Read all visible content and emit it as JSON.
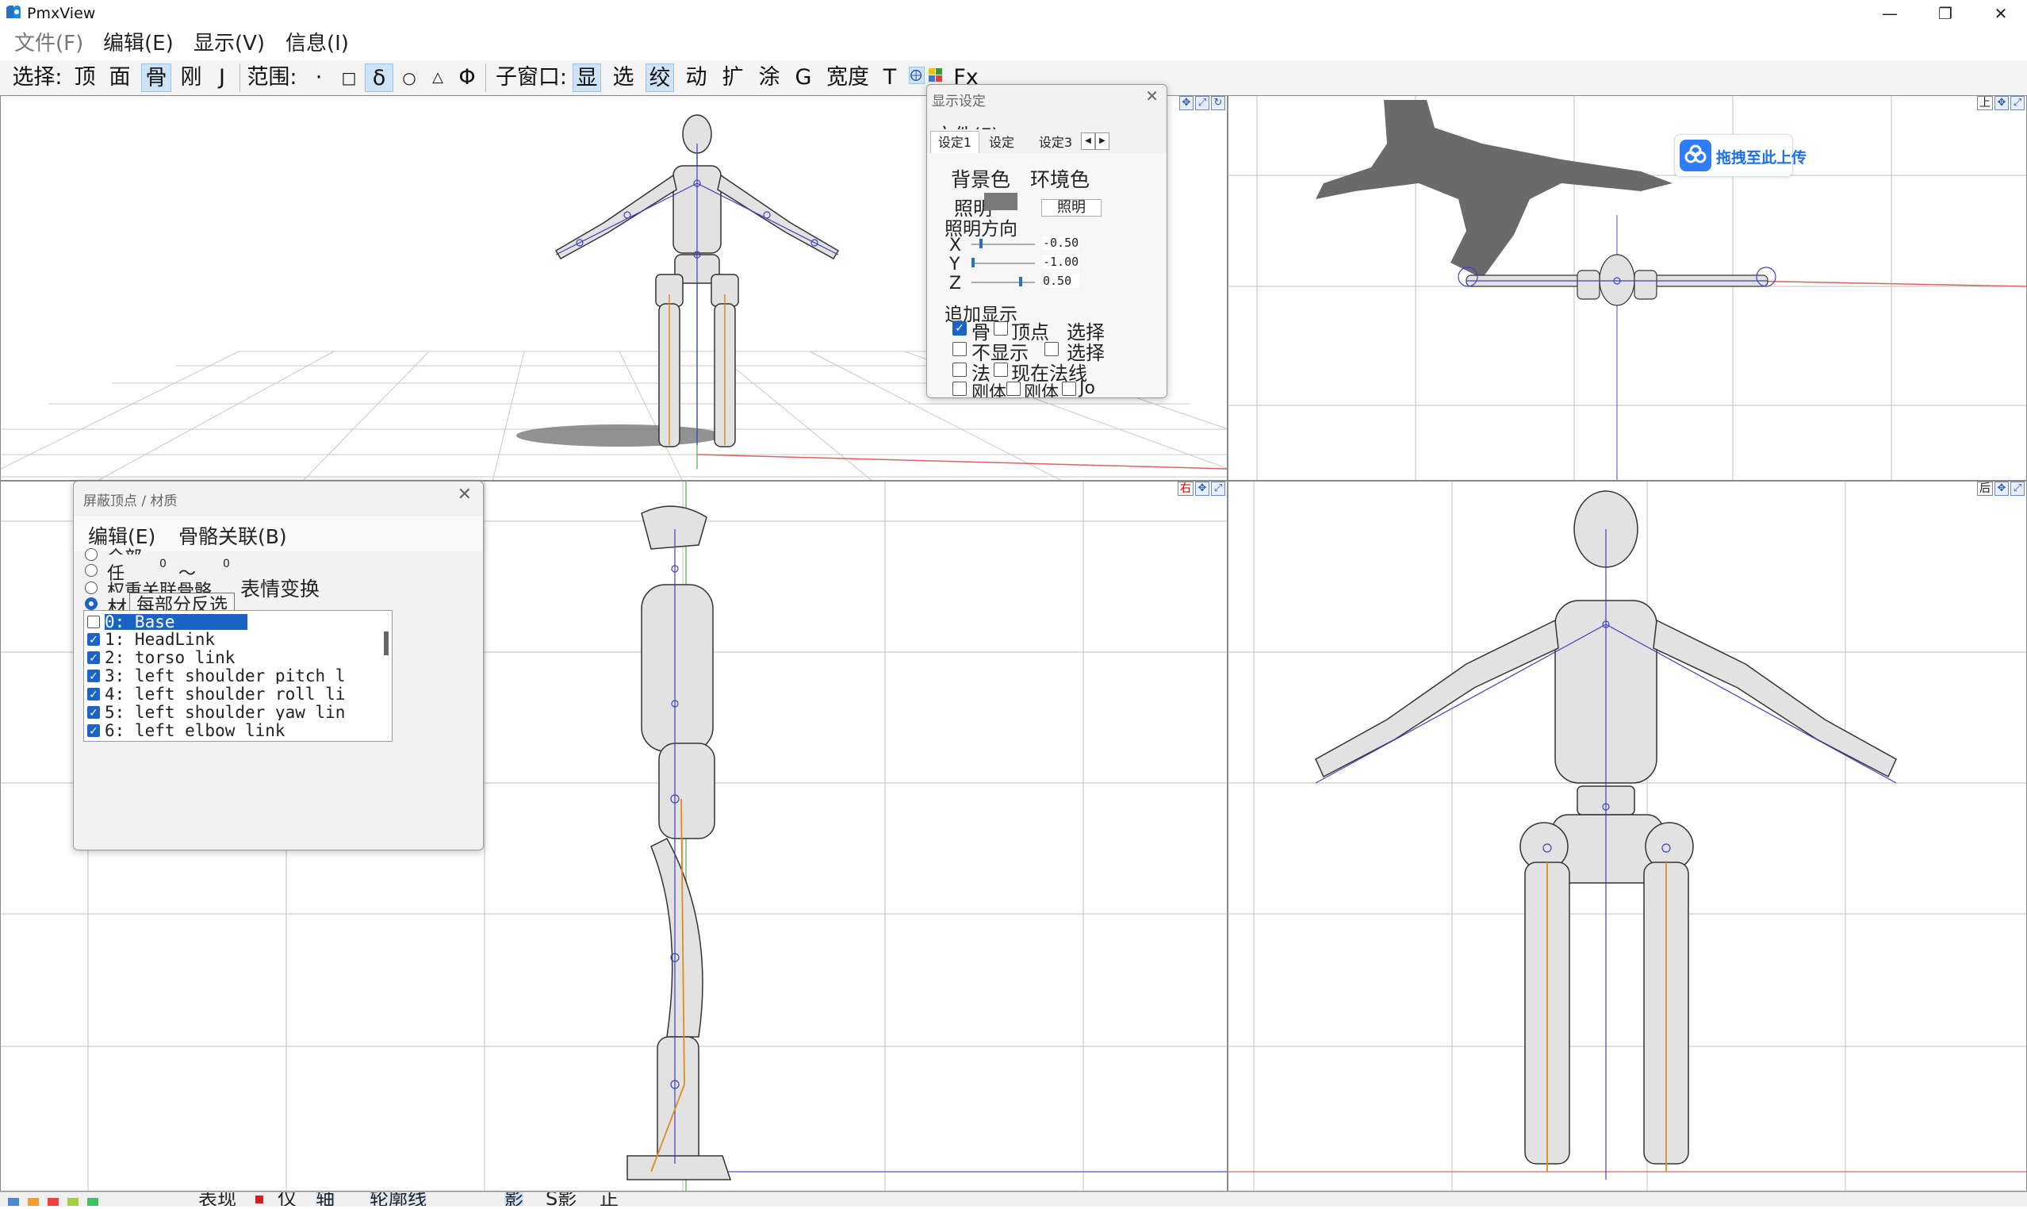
{
  "window": {
    "title": "PmxView",
    "minimize": "—",
    "maximize": "❐",
    "close": "✕"
  },
  "menu": [
    "文件(F)",
    "编辑(E)",
    "显示(V)",
    "信息(I)"
  ],
  "toolbar": {
    "select_label": "选择:",
    "select_items": [
      "顶",
      "面",
      "骨",
      "刚",
      "J"
    ],
    "range_label": "范围:",
    "range_items": [
      "·",
      "□",
      "δ",
      "○",
      "△",
      "Φ"
    ],
    "subwin_label": "子窗口:",
    "subwin_items": [
      "显",
      "选",
      "绞",
      "动",
      "扩",
      "涂",
      "G",
      "宽度",
      "T",
      "Fx"
    ]
  },
  "viewports": {
    "top_right_label": "上",
    "bottom_left_label": "右",
    "bottom_right_label": "后"
  },
  "upload_badge": {
    "text": "拖拽至此上传"
  },
  "display_settings": {
    "title": "显示设定",
    "tabs": [
      "设定1",
      "设定",
      "设定3"
    ],
    "file_menu": "文件(F)",
    "bg_color": "背景色",
    "env_color": "环境色",
    "lighting": "照明",
    "lighting_btn": "照明",
    "light_dir": "照明方向",
    "axes": [
      {
        "axis": "X",
        "value": "-0.50"
      },
      {
        "axis": "Y",
        "value": "-1.00"
      },
      {
        "axis": "Z",
        "value": "0.50"
      }
    ],
    "extra_display": "追加显示",
    "rows": [
      [
        "骨",
        "顶点",
        "选择"
      ],
      [
        "不显示",
        "选择"
      ],
      [
        "法",
        "现在法线"
      ],
      [
        "刚体",
        "刚体",
        "Jo"
      ]
    ],
    "row_checks": [
      [
        true,
        false
      ],
      [
        false,
        false
      ],
      [
        false,
        false
      ],
      [
        false,
        false,
        false
      ]
    ]
  },
  "mask_dialog": {
    "title": "屏蔽顶点 / 材质",
    "menu": [
      "编辑(E)",
      "骨骼关联(B)"
    ],
    "radio_all": "全部",
    "radio_any": "任",
    "range_from": "0",
    "range_tilde": "～",
    "range_to": "0",
    "radio_bone": "权重关联骨骼",
    "morph": "表情变换",
    "radio_mat": "材",
    "tooltip": "每部分反选",
    "materials": [
      {
        "label": "0: Base",
        "checked": false,
        "selected": true
      },
      {
        "label": "1: HeadLink",
        "checked": true,
        "selected": false
      },
      {
        "label": "2: torso link",
        "checked": true,
        "selected": false
      },
      {
        "label": "3: left shoulder pitch l",
        "checked": true,
        "selected": false
      },
      {
        "label": "4: left shoulder roll li",
        "checked": true,
        "selected": false
      },
      {
        "label": "5: left shoulder yaw lin",
        "checked": true,
        "selected": false
      },
      {
        "label": "6: left elbow link",
        "checked": true,
        "selected": false
      }
    ]
  },
  "status": {
    "items": [
      "表现",
      "仅",
      "轴",
      "轮廓线",
      "影",
      "S影",
      "正"
    ]
  }
}
